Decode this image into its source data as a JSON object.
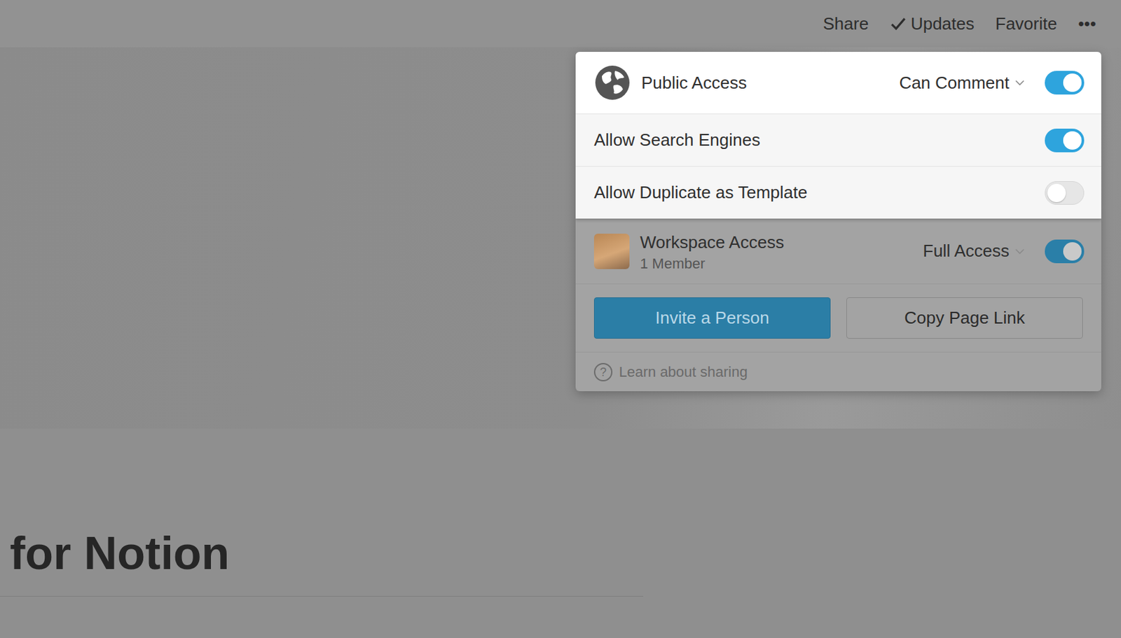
{
  "topbar": {
    "items": [
      {
        "label": "Share",
        "check": false
      },
      {
        "label": "Updates",
        "check": true
      },
      {
        "label": "Favorite",
        "check": false
      }
    ],
    "more": "•••"
  },
  "page": {
    "title": "for Notion"
  },
  "share_popup": {
    "public_access": {
      "label": "Public Access",
      "permission": "Can Comment",
      "on": true
    },
    "options": [
      {
        "label": "Allow Search Engines",
        "on": true
      },
      {
        "label": "Allow Duplicate as Template",
        "on": false
      }
    ],
    "workspace_access": {
      "label": "Workspace Access",
      "members": "1 Member",
      "permission": "Full Access",
      "on": true
    },
    "buttons": [
      "Invite a Person",
      "Copy Page Link"
    ],
    "help": {
      "icon": "?",
      "label": "Learn about sharing"
    }
  }
}
